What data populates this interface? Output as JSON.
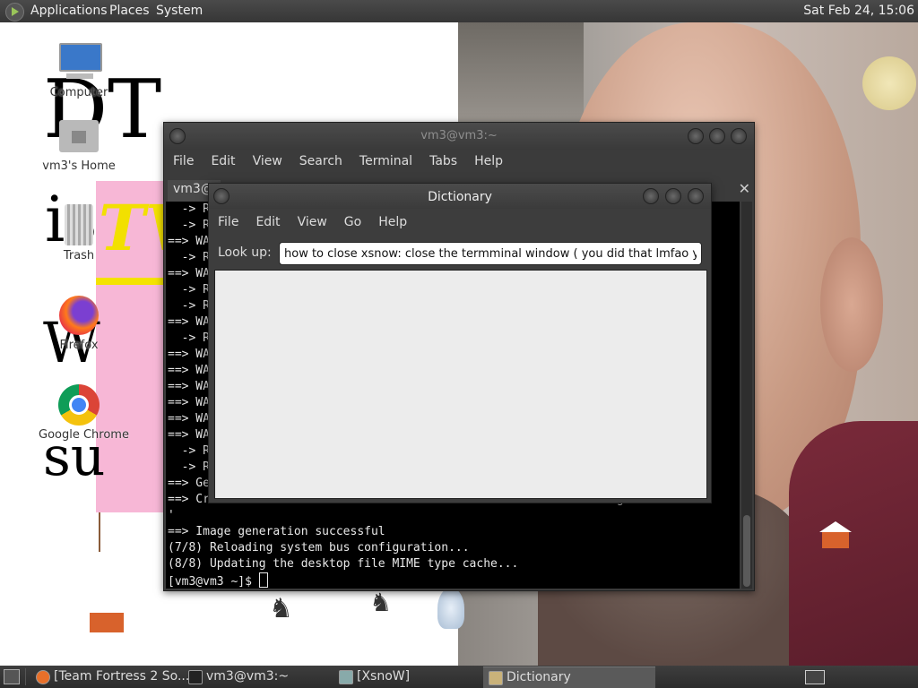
{
  "top_panel": {
    "menus": [
      "Applications",
      "Places",
      "System"
    ],
    "clock": "Sat Feb 24, 15:06"
  },
  "desktop": {
    "background_text": [
      "DT",
      "is",
      "TV",
      "W",
      "su"
    ],
    "icons": [
      {
        "label": "Computer",
        "icon": "computer-icon"
      },
      {
        "label": "vm3's Home",
        "icon": "home-folder-icon"
      },
      {
        "label": "Trash",
        "icon": "trash-icon"
      },
      {
        "label": "Firefox",
        "icon": "firefox-icon"
      },
      {
        "label": "Google Chrome",
        "icon": "chrome-icon"
      }
    ]
  },
  "terminal": {
    "title": "vm3@vm3:~",
    "menus": [
      "File",
      "Edit",
      "View",
      "Search",
      "Terminal",
      "Tabs",
      "Help"
    ],
    "tab_label": "vm3@",
    "close_glyph": "✕",
    "lines": [
      "  -> R",
      "  -> R",
      "==> WA",
      "  -> R",
      "==> WA",
      "  -> R",
      "  -> R",
      "==> WA",
      "  -> R",
      "==> WA",
      "==> WA",
      "==> WA",
      "==> WA",
      "==> WA",
      "==> WA",
      "  -> R",
      "  -> R",
      "==> Ge",
      "==> Cr                                                       .img",
      "'",
      "==> Image generation successful",
      "(7/8) Reloading system bus configuration...",
      "(8/8) Updating the desktop file MIME type cache..."
    ],
    "prompt": "[vm3@vm3 ~]$ "
  },
  "dictionary": {
    "title": "Dictionary",
    "menus": [
      "File",
      "Edit",
      "View",
      "Go",
      "Help"
    ],
    "lookup_label": "Look up:",
    "lookup_value": "how to close xsnow: close the termminal window ( you did that lmfao you do"
  },
  "taskbar": {
    "tasks": [
      {
        "label": "[Team Fortress 2 So...",
        "icon": "firefox-icon",
        "active": false
      },
      {
        "label": "vm3@vm3:~",
        "icon": "terminal-icon",
        "active": false
      },
      {
        "label": "[XsnoW]",
        "icon": "window-icon",
        "active": false
      },
      {
        "label": "Dictionary",
        "icon": "dictionary-icon",
        "active": true
      }
    ]
  }
}
